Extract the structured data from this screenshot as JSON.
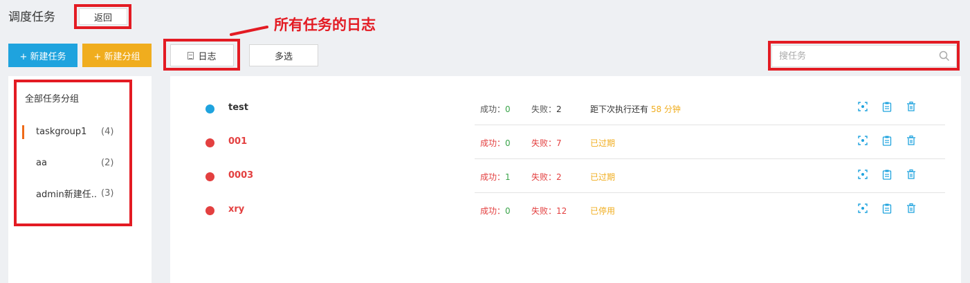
{
  "header": {
    "title": "调度任务",
    "back_label": "返回",
    "annotation": "所有任务的日志"
  },
  "toolbar": {
    "new_task_label": "+ 新建任务",
    "new_group_label": "+ 新建分组",
    "log_label": "日志",
    "multi_select_label": "多选"
  },
  "search": {
    "placeholder": "搜任务",
    "value": ""
  },
  "sidebar": {
    "title": "全部任务分组",
    "items": [
      {
        "label": "taskgroup1",
        "count": "(4)"
      },
      {
        "label": "aa",
        "count": "(2)"
      },
      {
        "label": "admin新建任..",
        "count": "(3)"
      }
    ]
  },
  "tasks": [
    {
      "name": "test",
      "dot_color": "#1fa3de",
      "success": "成功：",
      "success_count": "0",
      "fail": "失败：",
      "fail_count": "2",
      "status_prefix": "距下次执行还有 ",
      "status": "58 分钟"
    },
    {
      "name": "001",
      "dot_color": "#e34040",
      "success": "成功：",
      "success_count": "0",
      "fail": "失败：",
      "fail_count": "7",
      "status_prefix": "",
      "status": "已过期"
    },
    {
      "name": "0003",
      "dot_color": "#e34040",
      "success": "成功：",
      "success_count": "1",
      "fail": "失败：",
      "fail_count": "2",
      "status_prefix": "",
      "status": "已过期"
    },
    {
      "name": "xry",
      "dot_color": "#e34040",
      "success": "成功：",
      "success_count": "0",
      "fail": "失败：",
      "fail_count": "12",
      "status_prefix": "",
      "status": "已停用"
    }
  ],
  "colors": {
    "primary": "#1fa3de",
    "warning": "#f0ad1e",
    "danger": "#e34040",
    "success": "#3aa44a",
    "annotation_red": "#e31b23"
  },
  "icons": [
    "back-icon",
    "log-icon",
    "search-icon",
    "expand-icon",
    "clipboard-icon",
    "trash-icon"
  ]
}
